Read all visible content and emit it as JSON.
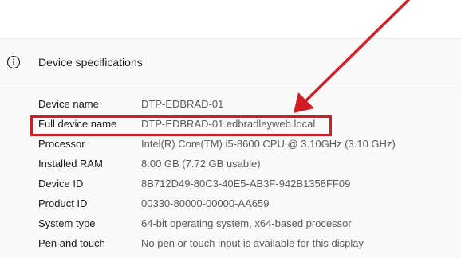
{
  "section": {
    "title": "Device specifications",
    "icon": "info-icon"
  },
  "specs": [
    {
      "label": "Device name",
      "value": "DTP-EDBRAD-01"
    },
    {
      "label": "Full device name",
      "value": "DTP-EDBRAD-01.edbradleyweb.local"
    },
    {
      "label": "Processor",
      "value": "Intel(R) Core(TM) i5-8600 CPU @ 3.10GHz (3.10 GHz)"
    },
    {
      "label": "Installed RAM",
      "value": "8.00 GB (7.72 GB usable)"
    },
    {
      "label": "Device ID",
      "value": "8B712D49-80C3-40E5-AB3F-942B1358FF09"
    },
    {
      "label": "Product ID",
      "value": "00330-80000-00000-AA659"
    },
    {
      "label": "System type",
      "value": "64-bit operating system, x64-based processor"
    },
    {
      "label": "Pen and touch",
      "value": "No pen or touch input is available for this display"
    }
  ],
  "annotation": {
    "highlighted_row": "Full device name",
    "color": "#d01e24"
  },
  "colors": {
    "background": "#f9f9f9",
    "label": "#1a1a1a",
    "value": "#5a5a5a",
    "accent": "#d01e24"
  }
}
